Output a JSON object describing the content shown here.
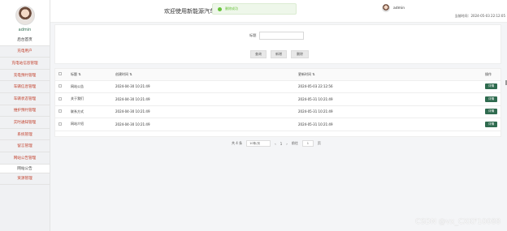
{
  "sidebar": {
    "username": "admin",
    "items": [
      {
        "label": "后台首页",
        "type": "home"
      },
      {
        "label": "充电用户",
        "type": "item"
      },
      {
        "label": "充电站信息管理",
        "type": "item"
      },
      {
        "label": "充电预约管理",
        "type": "item"
      },
      {
        "label": "车辆信息管理",
        "type": "item"
      },
      {
        "label": "车辆状态管理",
        "type": "item"
      },
      {
        "label": "维护预约管理",
        "type": "item"
      },
      {
        "label": "实时通知管理",
        "type": "item"
      },
      {
        "label": "系统管理",
        "type": "item"
      },
      {
        "label": "留言管理",
        "type": "item"
      },
      {
        "label": "网站公告管理",
        "type": "item"
      },
      {
        "label": "网站公告",
        "type": "sub"
      },
      {
        "label": "资源管理",
        "type": "item"
      }
    ]
  },
  "header": {
    "title": "欢迎使用新能源汽车",
    "toast": "删除成功",
    "username": "admin",
    "login_time": "当前时间：2024-05-03 22:12:05"
  },
  "search": {
    "label": "标题",
    "value": "",
    "buttons": [
      "查询",
      "新增",
      "删除"
    ]
  },
  "table": {
    "headers": [
      "",
      "标题",
      "创建时间",
      "更新时间",
      "操作"
    ],
    "rows": [
      {
        "title": "网站公告",
        "created": "2024-04-30 10:21:49",
        "updated": "2024-05-03 22:12:56",
        "action": "详情"
      },
      {
        "title": "关于我们",
        "created": "2024-04-30 10:21:49",
        "updated": "2024-05-31 10:21:49",
        "action": "详情"
      },
      {
        "title": "联系方式",
        "created": "2024-04-30 10:21:49",
        "updated": "2024-05-31 10:21:49",
        "action": "详情"
      },
      {
        "title": "网站介绍",
        "created": "2024-04-30 10:21:49",
        "updated": "2024-05-31 10:21:49",
        "action": "详情"
      }
    ]
  },
  "pagination": {
    "total": "共 4 条",
    "page_size": "10条/页",
    "prev": "‹",
    "current": "1",
    "next": "›",
    "goto": "前往",
    "goto_value": "1",
    "page_unit": "页"
  },
  "watermark": "CSDN @vx_CXKF10088",
  "colors": {
    "primary": "#2f6b4f",
    "menu_text": "#c2412d",
    "toast_success": "#67c23a"
  }
}
